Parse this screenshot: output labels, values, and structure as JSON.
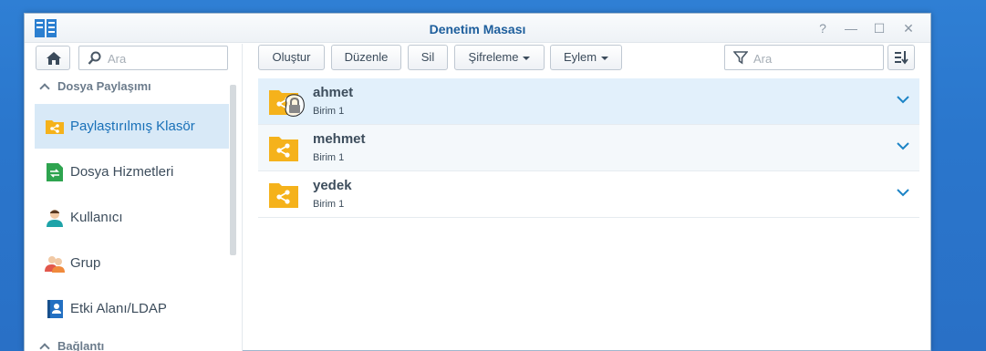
{
  "window": {
    "title": "Denetim Masası",
    "controls": [
      "?",
      "—",
      "☐",
      "✕"
    ]
  },
  "sidebar": {
    "search_placeholder": "Ara",
    "section1": "Dosya Paylaşımı",
    "section2": "Bağlantı",
    "items": [
      {
        "label": "Paylaştırılmış Klasör",
        "icon": "shared-folder-icon",
        "active": true
      },
      {
        "label": "Dosya Hizmetleri",
        "icon": "file-services-icon"
      },
      {
        "label": "Kullanıcı",
        "icon": "user-icon"
      },
      {
        "label": "Grup",
        "icon": "group-icon"
      },
      {
        "label": "Etki Alanı/LDAP",
        "icon": "domain-ldap-icon"
      }
    ]
  },
  "toolbar": {
    "create": "Oluştur",
    "edit": "Düzenle",
    "delete": "Sil",
    "encryption": "Şifreleme",
    "action": "Eylem",
    "search_placeholder": "Ara"
  },
  "folders": [
    {
      "name": "ahmet",
      "volume": "Birim 1",
      "locked": true,
      "selected": true
    },
    {
      "name": "mehmet",
      "volume": "Birim 1",
      "locked": false
    },
    {
      "name": "yedek",
      "volume": "Birim 1",
      "locked": false
    }
  ],
  "colors": {
    "accent": "#1870b8",
    "folder": "#f5b21b",
    "desktop": "#2a76cc"
  }
}
